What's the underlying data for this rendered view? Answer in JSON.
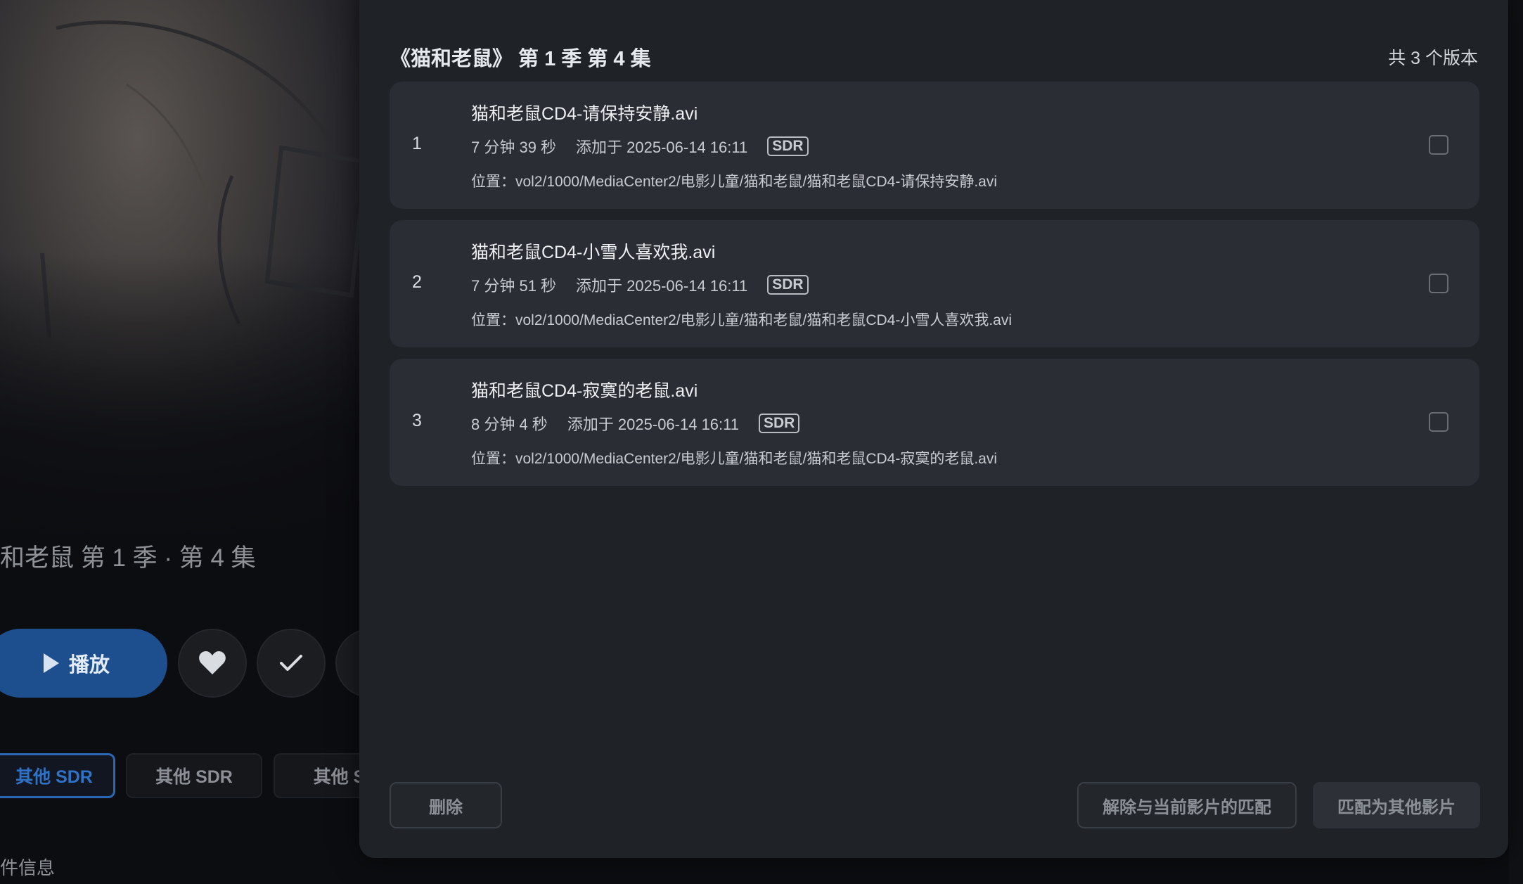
{
  "background": {
    "title": "和老鼠 第 1 季 · 第 4 集",
    "play_label": "播放",
    "version_tabs": [
      "其他 SDR",
      "其他 SDR",
      "其他 SI"
    ],
    "file_info_label": "件信息"
  },
  "modal": {
    "title": "《猫和老鼠》 第 1 季 第 4 集",
    "count": "共 3 个版本",
    "versions": [
      {
        "index": "1",
        "name": "猫和老鼠CD4-请保持安静.avi",
        "duration": "7 分钟 39 秒",
        "added": "添加于 2025-06-14 16:11",
        "badge": "SDR",
        "path": "位置：vol2/1000/MediaCenter2/电影儿童/猫和老鼠/猫和老鼠CD4-请保持安静.avi"
      },
      {
        "index": "2",
        "name": "猫和老鼠CD4-小雪人喜欢我.avi",
        "duration": "7 分钟 51 秒",
        "added": "添加于 2025-06-14 16:11",
        "badge": "SDR",
        "path": "位置：vol2/1000/MediaCenter2/电影儿童/猫和老鼠/猫和老鼠CD4-小雪人喜欢我.avi"
      },
      {
        "index": "3",
        "name": "猫和老鼠CD4-寂寞的老鼠.avi",
        "duration": "8 分钟 4 秒",
        "added": "添加于 2025-06-14 16:11",
        "badge": "SDR",
        "path": "位置：vol2/1000/MediaCenter2/电影儿童/猫和老鼠/猫和老鼠CD4-寂寞的老鼠.avi"
      }
    ],
    "buttons": {
      "delete": "删除",
      "unmatch": "解除与当前影片的匹配",
      "rematch": "匹配为其他影片"
    }
  },
  "colors": {
    "modal_bg": "#1f2227",
    "card_bg": "#2a2d33",
    "accent": "#2f73c9",
    "play_bg": "#1d4f8f"
  },
  "icons": {
    "play": "play-icon",
    "favorite": "heart-icon",
    "watched": "check-icon"
  }
}
